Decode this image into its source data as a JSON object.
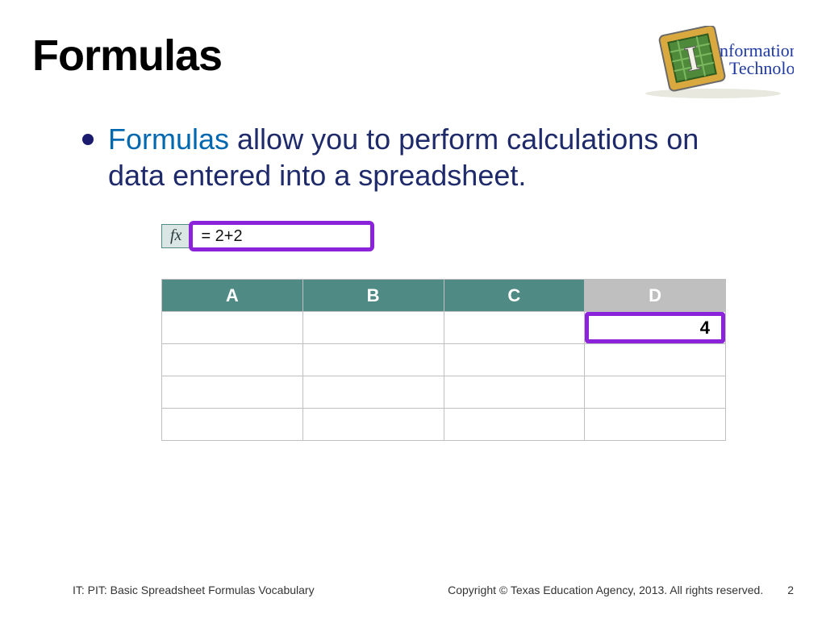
{
  "title": "Formulas",
  "logo": {
    "line1": "nformation",
    "line2": "Technology"
  },
  "bullet": {
    "strong": "Formulas",
    "rest": " allow you to perform calculations on data entered into a spreadsheet."
  },
  "fx": {
    "label": "fx",
    "formula": "= 2+2"
  },
  "columns": [
    "A",
    "B",
    "C",
    "D"
  ],
  "cell_value": "4",
  "footer": {
    "left": "IT: PIT: Basic Spreadsheet Formulas Vocabulary",
    "right": "Copyright © Texas Education Agency, 2013. All rights reserved.",
    "page": "2"
  }
}
